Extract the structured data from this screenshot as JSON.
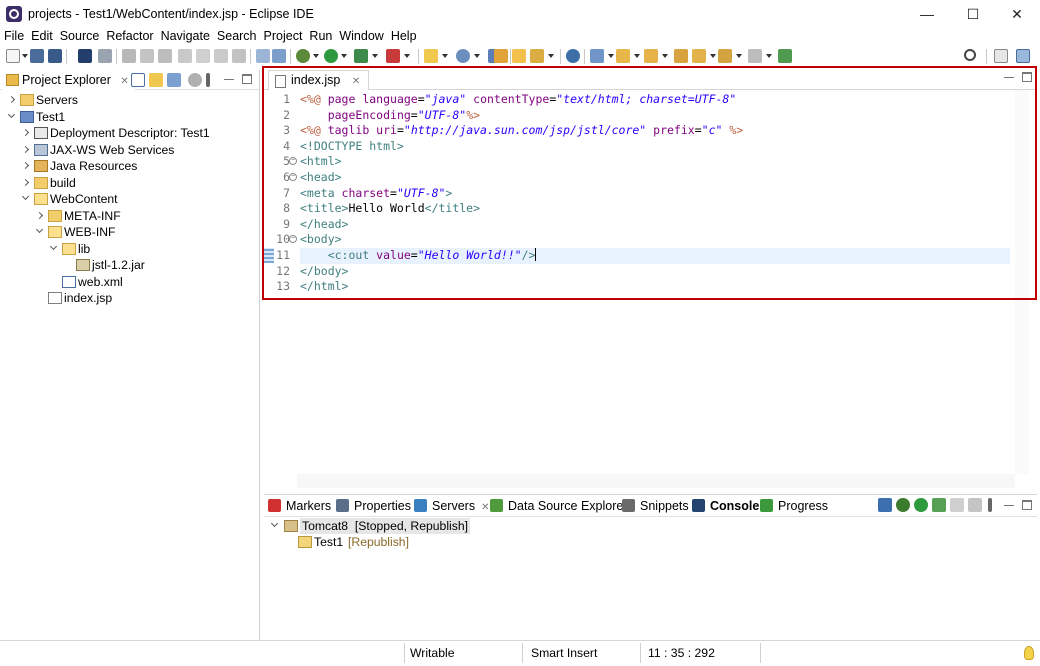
{
  "window": {
    "title": "projects - Test1/WebContent/index.jsp - Eclipse IDE",
    "minimize_glyph": "—",
    "maximize_glyph": "☐",
    "close_glyph": "✕"
  },
  "menu": [
    "File",
    "Edit",
    "Source",
    "Refactor",
    "Navigate",
    "Search",
    "Project",
    "Run",
    "Window",
    "Help"
  ],
  "project_explorer": {
    "tab_label": "Project Explorer",
    "close_glyph": "✕",
    "tree": [
      {
        "label": "Servers",
        "level": 0,
        "expander": "collapsed",
        "icon": "folder-icon"
      },
      {
        "label": "Test1",
        "level": 0,
        "expander": "expanded",
        "icon": "project-icon"
      },
      {
        "label": "Deployment Descriptor: Test1",
        "level": 1,
        "expander": "collapsed",
        "icon": "deployment-descriptor-icon"
      },
      {
        "label": "JAX-WS Web Services",
        "level": 1,
        "expander": "collapsed",
        "icon": "web-services-icon"
      },
      {
        "label": "Java Resources",
        "level": 1,
        "expander": "collapsed",
        "icon": "java-resources-icon"
      },
      {
        "label": "build",
        "level": 1,
        "expander": "collapsed",
        "icon": "folder-icon"
      },
      {
        "label": "WebContent",
        "level": 1,
        "expander": "expanded",
        "icon": "folder-open-icon"
      },
      {
        "label": "META-INF",
        "level": 2,
        "expander": "collapsed",
        "icon": "folder-icon"
      },
      {
        "label": "WEB-INF",
        "level": 2,
        "expander": "expanded",
        "icon": "folder-open-icon"
      },
      {
        "label": "lib",
        "level": 3,
        "expander": "expanded",
        "icon": "folder-open-icon"
      },
      {
        "label": "jstl-1.2.jar",
        "level": 4,
        "expander": "none",
        "icon": "jar-icon"
      },
      {
        "label": "web.xml",
        "level": 3,
        "expander": "none",
        "icon": "xml-file-icon"
      },
      {
        "label": "index.jsp",
        "level": 2,
        "expander": "none",
        "icon": "jsp-file-icon"
      }
    ]
  },
  "editor": {
    "tab_label": "index.jsp",
    "close_glyph": "✕",
    "active_line": 11,
    "lines": [
      {
        "n": "1",
        "fold": "",
        "segs": [
          [
            "dir",
            "<%@ "
          ],
          [
            "attr",
            "page "
          ],
          [
            "attr",
            "language"
          ],
          [
            "txt",
            "="
          ],
          [
            "str",
            "\"java\""
          ],
          [
            "txt",
            " "
          ],
          [
            "attr",
            "contentType"
          ],
          [
            "txt",
            "="
          ],
          [
            "str",
            "\"text/html; charset=UTF-8\""
          ]
        ]
      },
      {
        "n": "2",
        "fold": "",
        "segs": [
          [
            "txt",
            "    "
          ],
          [
            "attr",
            "pageEncoding"
          ],
          [
            "txt",
            "="
          ],
          [
            "str",
            "\"UTF-8\""
          ],
          [
            "dir",
            "%>"
          ]
        ]
      },
      {
        "n": "3",
        "fold": "",
        "segs": [
          [
            "dir",
            "<%@ "
          ],
          [
            "attr",
            "taglib "
          ],
          [
            "attr",
            "uri"
          ],
          [
            "txt",
            "="
          ],
          [
            "str",
            "\"http://java.sun.com/jsp/jstl/core\""
          ],
          [
            "txt",
            " "
          ],
          [
            "attr",
            "prefix"
          ],
          [
            "txt",
            "="
          ],
          [
            "str",
            "\"c\""
          ],
          [
            "txt",
            " "
          ],
          [
            "dir",
            "%>"
          ]
        ]
      },
      {
        "n": "4",
        "fold": "",
        "segs": [
          [
            "tag",
            "<!DOCTYPE html>"
          ]
        ]
      },
      {
        "n": "5",
        "fold": "⊖",
        "segs": [
          [
            "tag",
            "<html>"
          ]
        ]
      },
      {
        "n": "6",
        "fold": "⊖",
        "segs": [
          [
            "tag",
            "<head>"
          ]
        ]
      },
      {
        "n": "7",
        "fold": "",
        "segs": [
          [
            "tag",
            "<meta "
          ],
          [
            "attr",
            "charset"
          ],
          [
            "txt",
            "="
          ],
          [
            "str",
            "\"UTF-8\""
          ],
          [
            "tag",
            ">"
          ]
        ]
      },
      {
        "n": "8",
        "fold": "",
        "segs": [
          [
            "tag",
            "<title>"
          ],
          [
            "txt",
            "Hello World"
          ],
          [
            "tag",
            "</title>"
          ]
        ]
      },
      {
        "n": "9",
        "fold": "",
        "segs": [
          [
            "tag",
            "</head>"
          ]
        ]
      },
      {
        "n": "10",
        "fold": "⊖",
        "segs": [
          [
            "tag",
            "<body>"
          ]
        ]
      },
      {
        "n": "11",
        "fold": "",
        "segs": [
          [
            "txt",
            "    "
          ],
          [
            "tag",
            "<c:out "
          ],
          [
            "attr",
            "value"
          ],
          [
            "txt",
            "="
          ],
          [
            "str",
            "\"Hello World!!\""
          ],
          [
            "tag",
            "/>"
          ]
        ]
      },
      {
        "n": "12",
        "fold": "",
        "segs": [
          [
            "tag",
            "</body>"
          ]
        ]
      },
      {
        "n": "13",
        "fold": "",
        "segs": [
          [
            "tag",
            "</html>"
          ]
        ]
      }
    ]
  },
  "bottom_panel": {
    "tabs": [
      {
        "label": "Markers",
        "icon": "markers-icon",
        "color": "#d03030"
      },
      {
        "label": "Properties",
        "icon": "properties-icon",
        "color": "#5a6e8a"
      },
      {
        "label": "Servers",
        "icon": "servers-icon",
        "color": "#3a7fbf",
        "active": true
      },
      {
        "label": "Data Source Explorer",
        "icon": "data-source-icon",
        "color": "#4f9a3a"
      },
      {
        "label": "Snippets",
        "icon": "snippets-icon",
        "color": "#6a6a6a"
      },
      {
        "label": "Console",
        "icon": "console-icon",
        "color": "#23446e"
      },
      {
        "label": "Progress",
        "icon": "progress-icon",
        "color": "#3c9a3c"
      }
    ],
    "servers_close_glyph": "✕",
    "server": {
      "name": "Tomcat8",
      "state": "[Stopped, Republish]"
    },
    "module": {
      "name": "Test1",
      "state": "[Republish]"
    }
  },
  "status": {
    "writable": "Writable",
    "insert_mode": "Smart Insert",
    "position": "11 : 35 : 292"
  },
  "colors": {
    "highlight_border": "#c00000",
    "tag": "#3f7f7f",
    "attribute": "#7f007f",
    "string": "#2a00ff",
    "directive": "#bf5f3f"
  }
}
